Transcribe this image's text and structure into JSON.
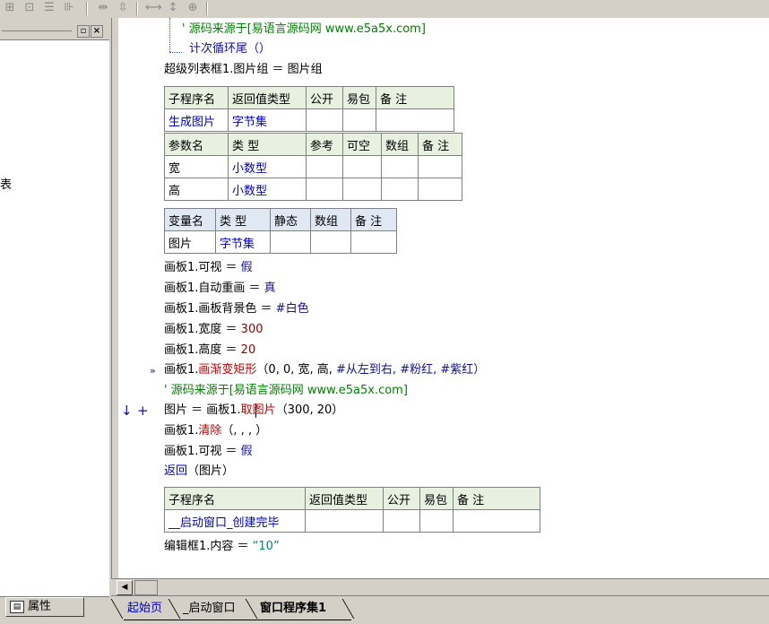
{
  "toolbar": {
    "icons": [
      "grid-icon",
      "layout-icon",
      "align-icon",
      "dist-icon",
      "h-space-icon",
      "v-space-icon",
      "h-size-icon",
      "v-size-icon",
      "size-icon"
    ]
  },
  "left_panel": {
    "partial_text": "表",
    "properties_tab": "属性"
  },
  "code": {
    "comment1": "' 源码来源于[易语言源码网 www.e5a5x.com]",
    "loop_end": "计次循环尾（）",
    "assign_list": "超级列表框1.图片组 ＝ 图片组",
    "sub1_table": {
      "header": [
        "子程序名",
        "返回值类型",
        "公开",
        "易包",
        "备 注"
      ],
      "row": [
        "生成图片",
        "字节集",
        "",
        "",
        ""
      ]
    },
    "param_table": {
      "header": [
        "参数名",
        "类 型",
        "参考",
        "可空",
        "数组",
        "备 注"
      ],
      "rows": [
        [
          "宽",
          "小数型",
          "",
          "",
          "",
          ""
        ],
        [
          "高",
          "小数型",
          "",
          "",
          "",
          ""
        ]
      ]
    },
    "var_table": {
      "header": [
        "变量名",
        "类 型",
        "静态",
        "数组",
        "备 注"
      ],
      "row": [
        "图片",
        "字节集",
        "",
        "",
        ""
      ]
    },
    "lines": {
      "l1_obj": "画板1.可视 ＝ ",
      "l1_val": "假",
      "l2_obj": "画板1.自动重画 ＝ ",
      "l2_val": "真",
      "l3_obj": "画板1.画板背景色 ＝ ",
      "l3_val": "#白色",
      "l4_obj": "画板1.宽度 ＝ ",
      "l4_val": "300",
      "l5_obj": "画板1.高度 ＝ ",
      "l5_val": "20",
      "l6_obj": "画板1.",
      "l6_func": "画渐变矩形",
      "l6_args_a": "（0, 0, 宽, 高, ",
      "l6_args_b": "#从左到右, #粉红, #紫红）",
      "l7_comment": "' 源码来源于[易语言源码网 www.e5a5x.com]",
      "l8_obj": "图片 ＝ 画板1.",
      "l8_func": "取图片",
      "l8_args": "（300, 20）",
      "l9_obj": "画板1.",
      "l9_func": "清除",
      "l9_args": "（, , , ）",
      "l10_obj": "画板1.可视 ＝ ",
      "l10_val": "假",
      "l11_func": "返回",
      "l11_args": "（图片）"
    },
    "sub2_table": {
      "header": [
        "子程序名",
        "返回值类型",
        "公开",
        "易包",
        "备 注"
      ],
      "row": [
        "__启动窗口_创建完毕",
        "",
        "",
        "",
        ""
      ]
    },
    "edit_line_obj": "编辑框1.内容 ＝ ",
    "edit_line_val": "“10”",
    "arrow_marker": "↓",
    "plus_marker": "+",
    "exec_marker": "»"
  },
  "tabs": [
    "起始页",
    "_启动窗口",
    "窗口程序集1"
  ],
  "active_tab": "窗口程序集1"
}
